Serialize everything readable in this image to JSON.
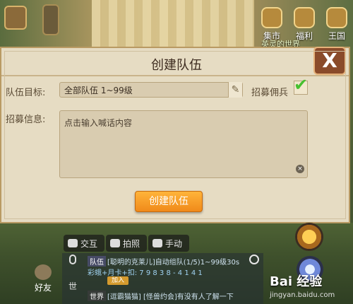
{
  "top_icons": [
    {
      "label": "集市",
      "icon": "market-icon"
    },
    {
      "label": "福利",
      "icon": "gift-icon"
    },
    {
      "label": "王国",
      "icon": "crown-icon"
    }
  ],
  "top_banner": "英灵的世界",
  "dialog": {
    "title": "创建队伍",
    "target_label": "队伍目标:",
    "target_value": "全部队伍 1~99级",
    "recruit_label": "招募佣兵",
    "recruit_checked": true,
    "message_label": "招募信息:",
    "message_placeholder": "点击输入喊话内容",
    "create_button": "创建队伍",
    "close_symbol": "X"
  },
  "chat": {
    "tabs": [
      {
        "label": "交互",
        "icon": "chat-icon"
      },
      {
        "label": "拍照",
        "icon": "camera-icon"
      },
      {
        "label": "手动",
        "icon": "monitor-icon"
      }
    ],
    "voice_label": "语音",
    "world_side_label": "世",
    "lines": [
      {
        "channel": "队伍",
        "text": "[聪明的克莱儿]自动组队(1/5)1~99级30s"
      },
      {
        "channel": "",
        "text": "彩蛾+月卡+扣: 7 9 8 3 8 - 4 1 4 1"
      },
      {
        "channel": "世界",
        "text": "[逗霸猫猫] [怪兽约会]有没有人了解一下"
      }
    ],
    "join_button": "加入"
  },
  "friend_label": "好友",
  "watermark": {
    "main": "Bai 经验",
    "url": "jingyan.baidu.com"
  },
  "colors": {
    "dialog_bg": "#e6dcc3",
    "button_orange": "#f5a026",
    "check_green": "#46c030",
    "close_bg": "#8a4b2a"
  }
}
